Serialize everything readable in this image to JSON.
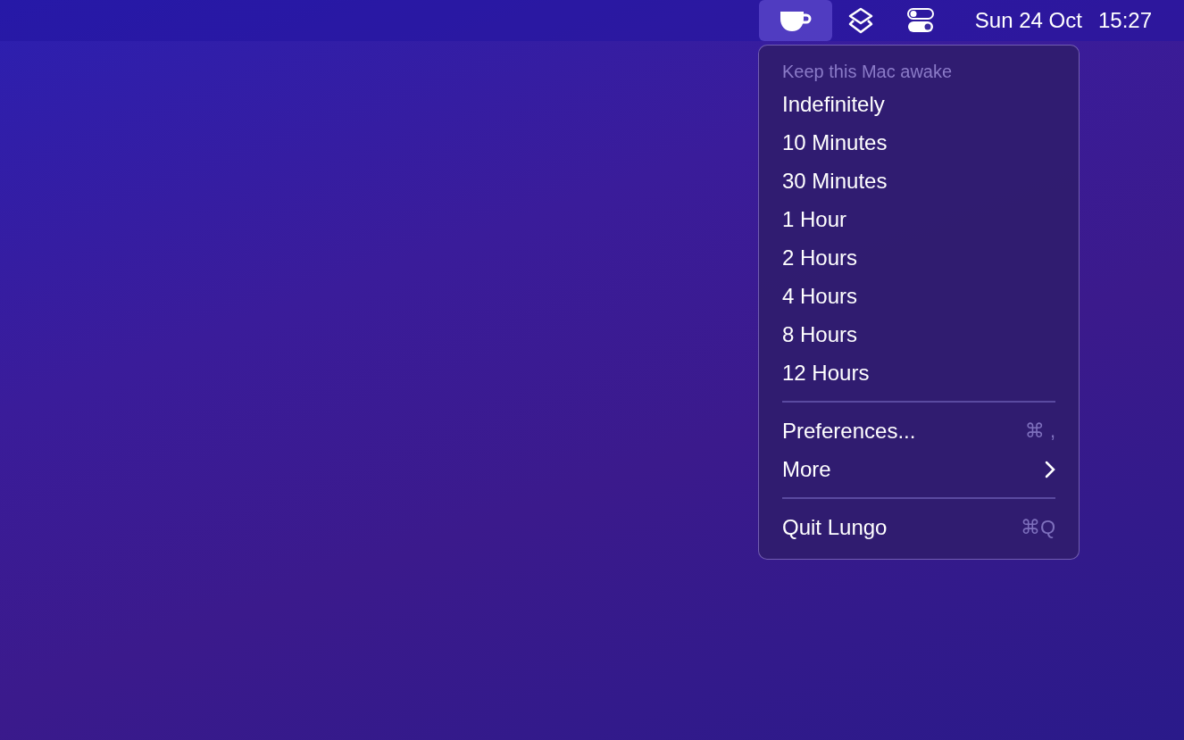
{
  "menu_bar": {
    "status_items": [
      {
        "kind": "cup",
        "selected": true
      },
      {
        "kind": "layers",
        "selected": false
      },
      {
        "kind": "toggles",
        "selected": false
      }
    ],
    "date": "Sun 24 Oct",
    "time": "15:27"
  },
  "menu": {
    "header": "Keep this Mac awake",
    "sections": [
      [
        {
          "label": "Indefinitely"
        },
        {
          "label": "10 Minutes"
        },
        {
          "label": "30 Minutes"
        },
        {
          "label": "1 Hour"
        },
        {
          "label": "2 Hours"
        },
        {
          "label": "4 Hours"
        },
        {
          "label": "8 Hours"
        },
        {
          "label": "12 Hours"
        }
      ],
      [
        {
          "label": "Preferences...",
          "shortcut": "⌘ ,"
        },
        {
          "label": "More",
          "submenu": true
        }
      ],
      [
        {
          "label": "Quit Lungo",
          "shortcut": "⌘Q"
        }
      ]
    ]
  }
}
